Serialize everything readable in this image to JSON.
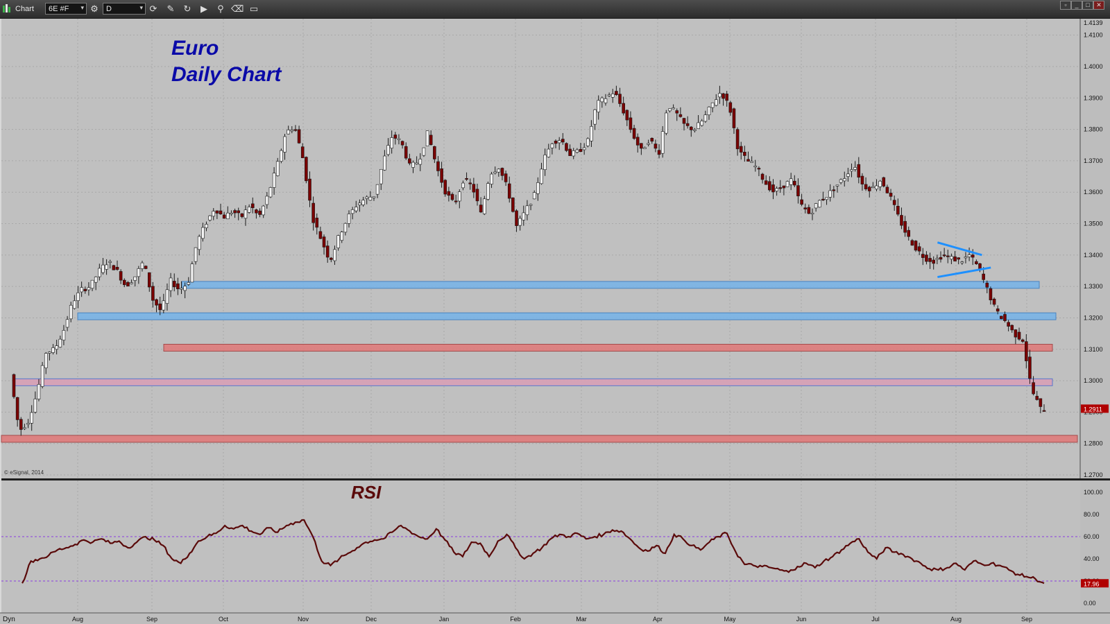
{
  "app": {
    "title": "Chart",
    "symbol": "6E #F",
    "interval": "D",
    "mode": "Dyn"
  },
  "icons": [
    "chart-app-icon",
    "settings-gear-icon",
    "cycle-icon",
    "pencil-draw-icon",
    "refresh-icon",
    "play-icon",
    "zoom-icon",
    "eraser-icon",
    "comment-icon",
    "restore-window-icon",
    "minimize-window-icon",
    "maximize-window-icon",
    "close-window-icon"
  ],
  "colors": {
    "chart_bg": "#c0c0c0",
    "bull": "#f4f4f4",
    "bear": "#7a0000",
    "rsi": "#5a0a0a",
    "title": "#0a0aa8",
    "blue_zone": "#78b4e8",
    "red_zone": "#e07a7a",
    "pattern": "#1e90ff",
    "price_badge": "#b00000"
  },
  "annotation": {
    "line1": "Euro",
    "line2": "Daily Chart",
    "rsi": "RSI"
  },
  "watermark": "© eSignal, 2014",
  "chart_data": [
    {
      "type": "candlestick",
      "symbol": "6E #F",
      "title": "Euro Daily Chart",
      "ylim": [
        1.27,
        1.4139
      ],
      "y_ticks": [
        "1.4139",
        "1.4100",
        "1.4000",
        "1.3900",
        "1.3800",
        "1.3700",
        "1.3600",
        "1.3500",
        "1.3400",
        "1.3300",
        "1.3200",
        "1.3100",
        "1.3000",
        "1.2900",
        "1.2800",
        "1.2700"
      ],
      "x_ticks": [
        "Aug",
        "Sep",
        "Oct",
        "Nov",
        "Dec",
        "Jan",
        "Feb",
        "Mar",
        "Apr",
        "May",
        "Jun",
        "Jul",
        "Aug",
        "Sep"
      ],
      "last_price": "1.2911",
      "close_path": [
        [
          0,
          1.302
        ],
        [
          1,
          1.284
        ],
        [
          2,
          1.287
        ],
        [
          3,
          1.296
        ],
        [
          4,
          1.309
        ],
        [
          5,
          1.31
        ],
        [
          6,
          1.316
        ],
        [
          7,
          1.325
        ],
        [
          8,
          1.329
        ],
        [
          9,
          1.33
        ],
        [
          10,
          1.335
        ],
        [
          11,
          1.338
        ],
        [
          12,
          1.335
        ],
        [
          13,
          1.33
        ],
        [
          14,
          1.333
        ],
        [
          15,
          1.338
        ],
        [
          16,
          1.326
        ],
        [
          17,
          1.322
        ],
        [
          18,
          1.332
        ],
        [
          19,
          1.329
        ],
        [
          20,
          1.331
        ],
        [
          21,
          1.344
        ],
        [
          22,
          1.35
        ],
        [
          23,
          1.355
        ],
        [
          24,
          1.352
        ],
        [
          25,
          1.354
        ],
        [
          26,
          1.352
        ],
        [
          27,
          1.356
        ],
        [
          28,
          1.352
        ],
        [
          29,
          1.359
        ],
        [
          30,
          1.368
        ],
        [
          31,
          1.379
        ],
        [
          32,
          1.381
        ],
        [
          33,
          1.37
        ],
        [
          34,
          1.352
        ],
        [
          35,
          1.345
        ],
        [
          36,
          1.338
        ],
        [
          37,
          1.346
        ],
        [
          38,
          1.352
        ],
        [
          39,
          1.356
        ],
        [
          40,
          1.358
        ],
        [
          41,
          1.359
        ],
        [
          42,
          1.37
        ],
        [
          43,
          1.378
        ],
        [
          44,
          1.376
        ],
        [
          45,
          1.368
        ],
        [
          46,
          1.37
        ],
        [
          47,
          1.379
        ],
        [
          48,
          1.368
        ],
        [
          49,
          1.36
        ],
        [
          50,
          1.356
        ],
        [
          51,
          1.364
        ],
        [
          52,
          1.362
        ],
        [
          53,
          1.353
        ],
        [
          54,
          1.366
        ],
        [
          55,
          1.368
        ],
        [
          56,
          1.361
        ],
        [
          57,
          1.349
        ],
        [
          58,
          1.354
        ],
        [
          59,
          1.359
        ],
        [
          60,
          1.37
        ],
        [
          61,
          1.376
        ],
        [
          62,
          1.377
        ],
        [
          63,
          1.372
        ],
        [
          64,
          1.373
        ],
        [
          65,
          1.376
        ],
        [
          66,
          1.388
        ],
        [
          67,
          1.39
        ],
        [
          68,
          1.392
        ],
        [
          69,
          1.386
        ],
        [
          70,
          1.379
        ],
        [
          71,
          1.373
        ],
        [
          72,
          1.377
        ],
        [
          73,
          1.372
        ],
        [
          74,
          1.388
        ],
        [
          75,
          1.385
        ],
        [
          76,
          1.381
        ],
        [
          77,
          1.38
        ],
        [
          78,
          1.383
        ],
        [
          79,
          1.388
        ],
        [
          80,
          1.392
        ],
        [
          81,
          1.387
        ],
        [
          82,
          1.373
        ],
        [
          83,
          1.37
        ],
        [
          84,
          1.368
        ],
        [
          85,
          1.363
        ],
        [
          86,
          1.36
        ],
        [
          87,
          1.362
        ],
        [
          88,
          1.364
        ],
        [
          89,
          1.356
        ],
        [
          90,
          1.353
        ],
        [
          91,
          1.357
        ],
        [
          92,
          1.359
        ],
        [
          93,
          1.362
        ],
        [
          94,
          1.365
        ],
        [
          95,
          1.369
        ],
        [
          96,
          1.362
        ],
        [
          97,
          1.361
        ],
        [
          98,
          1.364
        ],
        [
          99,
          1.359
        ],
        [
          100,
          1.352
        ],
        [
          101,
          1.346
        ],
        [
          102,
          1.342
        ],
        [
          103,
          1.339
        ],
        [
          104,
          1.338
        ],
        [
          105,
          1.34
        ],
        [
          106,
          1.339
        ],
        [
          107,
          1.338
        ],
        [
          108,
          1.34
        ],
        [
          109,
          1.336
        ],
        [
          110,
          1.329
        ],
        [
          111,
          1.322
        ],
        [
          112,
          1.319
        ],
        [
          113,
          1.315
        ],
        [
          114,
          1.313
        ],
        [
          115,
          1.297
        ],
        [
          116,
          1.2911
        ]
      ],
      "levels": [
        {
          "type": "support_zone",
          "color": "blue",
          "price": 1.3305
        },
        {
          "type": "support_zone",
          "color": "blue",
          "price": 1.3205
        },
        {
          "type": "support_zone",
          "color": "red",
          "price": 1.3105
        },
        {
          "type": "support_zone",
          "color": "red_blue",
          "price": 1.2995
        },
        {
          "type": "support_zone",
          "color": "red",
          "price": 1.2815
        }
      ],
      "pattern": {
        "type": "pennant",
        "upper": [
          [
            104,
            1.344
          ],
          [
            109,
            1.34
          ]
        ],
        "lower": [
          [
            104,
            1.333
          ],
          [
            110,
            1.336
          ]
        ]
      }
    },
    {
      "type": "line",
      "title": "RSI",
      "ylim": [
        0,
        100
      ],
      "y_ticks": [
        "100.00",
        "80.00",
        "60.00",
        "40.00",
        "20.00",
        "0.00"
      ],
      "reference_lines": [
        60,
        20
      ],
      "last_value": "17.96",
      "series": [
        {
          "values": [
            18,
            38,
            40,
            43,
            48,
            50,
            53,
            57,
            55,
            58,
            54,
            56,
            50,
            55,
            60,
            57,
            52,
            40,
            36,
            45,
            56,
            60,
            63,
            70,
            67,
            70,
            65,
            62,
            68,
            64,
            70,
            73,
            75,
            60,
            38,
            34,
            40,
            45,
            50,
            55,
            57,
            58,
            64,
            70,
            65,
            60,
            58,
            67,
            57,
            46,
            42,
            55,
            54,
            42,
            56,
            62,
            50,
            40,
            45,
            50,
            58,
            62,
            60,
            63,
            58,
            60,
            62,
            66,
            65,
            58,
            50,
            47,
            52,
            45,
            62,
            58,
            52,
            48,
            55,
            60,
            63,
            46,
            35,
            34,
            33,
            32,
            30,
            28,
            33,
            36,
            32,
            38,
            42,
            48,
            54,
            58,
            46,
            40,
            50,
            46,
            44,
            40,
            36,
            31,
            30,
            32,
            36,
            30,
            38,
            35,
            36,
            34,
            30,
            26,
            24,
            22,
            18
          ]
        }
      ]
    }
  ]
}
